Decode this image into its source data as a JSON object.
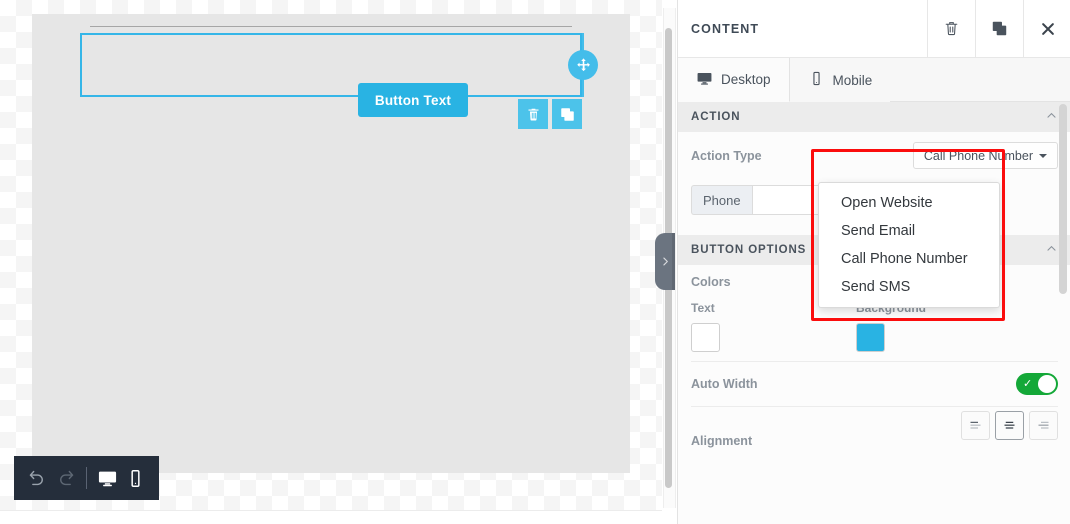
{
  "canvas": {
    "button_text": "Button Text",
    "move_handle_icon": "move-arrows-icon",
    "delete_icon": "trash-icon",
    "duplicate_icon": "duplicate-icon",
    "collapse_icon": "chevron-right-icon"
  },
  "bottom_toolbar": {
    "undo_icon": "undo-icon",
    "redo_icon": "redo-icon",
    "desktop_icon": "desktop-icon",
    "mobile_icon": "mobile-icon"
  },
  "panel": {
    "title": "CONTENT",
    "header_actions": [
      {
        "name": "delete",
        "icon": "trash-icon"
      },
      {
        "name": "duplicate",
        "icon": "duplicate-icon"
      },
      {
        "name": "close",
        "icon": "close-icon"
      }
    ],
    "tabs": [
      {
        "label": "Desktop",
        "icon": "desktop-icon",
        "active": true
      },
      {
        "label": "Mobile",
        "icon": "mobile-icon",
        "active": false
      }
    ],
    "action_section": {
      "title": "ACTION",
      "collapse_icon": "chevron-up-icon",
      "action_type_label": "Action Type",
      "action_type_value": "Call Phone Number",
      "phone_addon_label": "Phone",
      "phone_value": "",
      "phone_placeholder": ""
    },
    "dropdown": {
      "open": true,
      "options": [
        "Open Website",
        "Send Email",
        "Call Phone Number",
        "Send SMS"
      ],
      "highlight_color": "#fb0d0d"
    },
    "button_options_section": {
      "title": "BUTTON OPTIONS",
      "collapse_icon": "chevron-up-icon",
      "colors_label": "Colors",
      "text_color_label": "Text",
      "text_color_value": "#ffffff",
      "background_color_label": "Background",
      "background_color_value": "#29b3e3",
      "auto_width_label": "Auto Width",
      "auto_width_on": true,
      "alignment_label": "Alignment",
      "alignment_options": [
        "left",
        "center",
        "right"
      ],
      "alignment_selected": "center"
    }
  }
}
